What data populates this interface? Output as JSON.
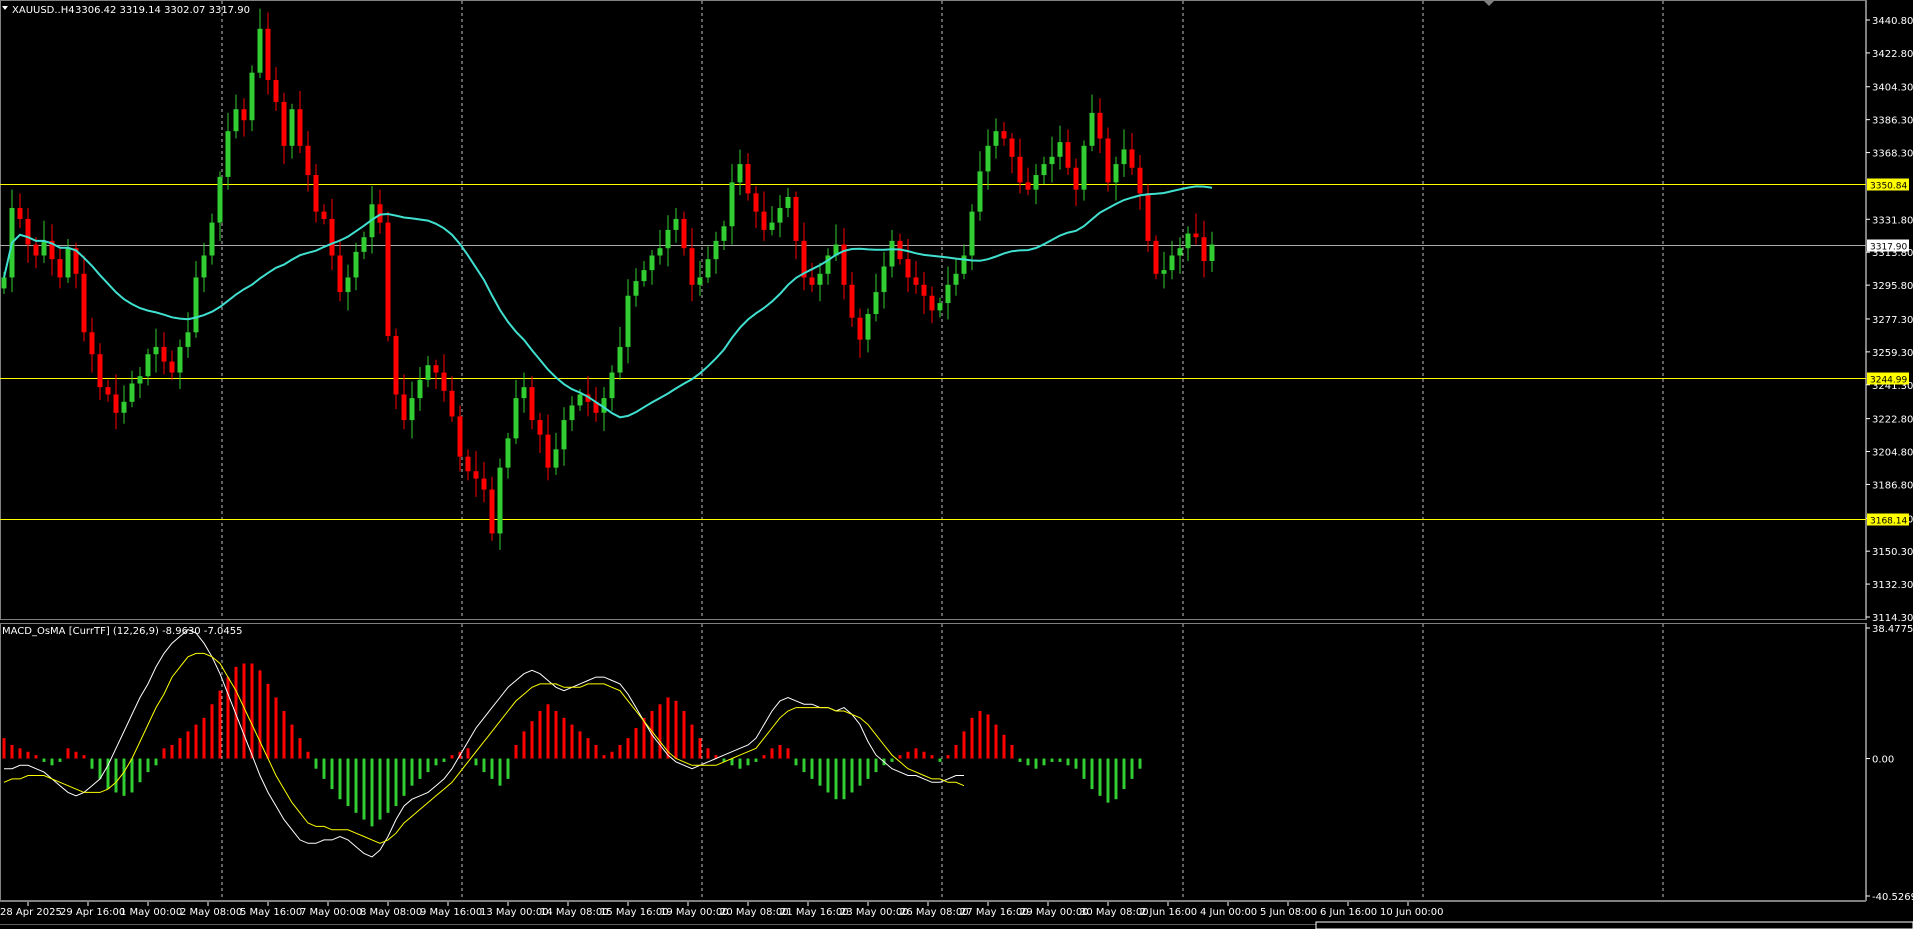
{
  "window": {
    "symbol_label": "XAUUSD..H4",
    "ohlc_readout": "3306.42 3319.14 3302.07 3317.90",
    "indicator_label": "MACD_OsMA [CurrTF] (12,26,9) -8.9630 -7.0455"
  },
  "colors": {
    "background": "#000000",
    "bull": "#32cd32",
    "bear": "#ff0000",
    "ma": "#40e0d0",
    "hline": "#ffff00",
    "grid": "#c0c0c0",
    "macd_main": "#ffffff",
    "macd_signal": "#ffff00",
    "axis_text": "#ffffff",
    "current_price_line": "#a9a9a9"
  },
  "chart_data": [
    {
      "type": "candlestick",
      "symbol": "XAUUSD..H4",
      "ylim": [
        3114.3,
        3440.8
      ],
      "y_ticks": [
        "3440.80",
        "3422.80",
        "3404.30",
        "3386.30",
        "3368.30",
        "3331.80",
        "3313.80",
        "3295.80",
        "3277.30",
        "3259.30",
        "3241.30",
        "3222.80",
        "3204.80",
        "3186.80",
        "3168.30",
        "3150.30",
        "3132.30",
        "3114.30"
      ],
      "x_ticks": [
        "28 Apr 2025",
        "29 Apr 16:00",
        "1 May 00:00",
        "2 May 08:00",
        "5 May 16:00",
        "7 May 00:00",
        "8 May 08:00",
        "9 May 16:00",
        "13 May 00:00",
        "14 May 08:00",
        "15 May 16:00",
        "19 May 00:00",
        "20 May 08:00",
        "21 May 16:00",
        "23 May 00:00",
        "26 May 08:00",
        "27 May 16:00",
        "29 May 00:00",
        "30 May 08:00",
        "2 Jun 16:00",
        "4 Jun 00:00",
        "5 Jun 08:00",
        "6 Jun 16:00",
        "10 Jun 00:00"
      ],
      "horizontal_levels": [
        {
          "label": "3350.84",
          "value": 3350.84,
          "style": "yellow"
        },
        {
          "label": "3244.99",
          "value": 3244.99,
          "style": "yellow"
        },
        {
          "label": "3168.14",
          "value": 3168.14,
          "style": "yellow"
        },
        {
          "label": "3317.90",
          "value": 3317.9,
          "style": "current"
        }
      ],
      "ma_period_note": "",
      "closes": [
        3300,
        3338,
        3332,
        3318,
        3312,
        3320,
        3310,
        3300,
        3316,
        3302,
        3270,
        3258,
        3240,
        3236,
        3226,
        3232,
        3242,
        3246,
        3258,
        3262,
        3254,
        3248,
        3262,
        3270,
        3300,
        3312,
        3330,
        3355,
        3380,
        3392,
        3386,
        3412,
        3436,
        3408,
        3396,
        3372,
        3392,
        3372,
        3356,
        3336,
        3332,
        3312,
        3292,
        3300,
        3314,
        3322,
        3340,
        3330,
        3268,
        3236,
        3222,
        3234,
        3244,
        3252,
        3248,
        3238,
        3224,
        3202,
        3194,
        3190,
        3184,
        3160,
        3196,
        3212,
        3234,
        3240,
        3222,
        3214,
        3196,
        3206,
        3222,
        3230,
        3236,
        3232,
        3226,
        3234,
        3248,
        3262,
        3290,
        3298,
        3304,
        3312,
        3316,
        3326,
        3332,
        3316,
        3296,
        3300,
        3310,
        3320,
        3328,
        3352,
        3362,
        3346,
        3336,
        3326,
        3330,
        3338,
        3344,
        3320,
        3300,
        3296,
        3302,
        3312,
        3318,
        3296,
        3278,
        3266,
        3280,
        3292,
        3306,
        3320,
        3310,
        3300,
        3296,
        3290,
        3282,
        3286,
        3296,
        3302,
        3312,
        3336,
        3358,
        3372,
        3380,
        3376,
        3366,
        3352,
        3348,
        3356,
        3362,
        3366,
        3374,
        3360,
        3348,
        3372,
        3390,
        3376,
        3352,
        3362,
        3370,
        3360,
        3346,
        3320,
        3302,
        3304,
        3312,
        3316,
        3324,
        3322,
        3309,
        3318
      ]
    },
    {
      "type": "bar",
      "name": "",
      "ylim": [
        -40.5269,
        38.4775
      ],
      "y_ticks": [
        "38.4775",
        "0.00",
        "-40.5269"
      ],
      "osma_bars": [
        6,
        4,
        3,
        2,
        1,
        -1,
        -2,
        -1,
        3,
        2,
        1,
        -3,
        -6,
        -9,
        -10,
        -11,
        -10,
        -7,
        -4,
        -2,
        3,
        4,
        6,
        8,
        10,
        12,
        16,
        20,
        24,
        27,
        28,
        28,
        26,
        22,
        18,
        14,
        10,
        6,
        2,
        -3,
        -6,
        -9,
        -12,
        -14,
        -16,
        -18,
        -20,
        -18,
        -16,
        -14,
        -11,
        -8,
        -6,
        -4,
        -2,
        -1,
        1,
        2,
        3,
        -2,
        -4,
        -6,
        -8,
        -6,
        4,
        8,
        11,
        14,
        16,
        14,
        12,
        10,
        8,
        6,
        4,
        1,
        2,
        4,
        6,
        9,
        12,
        14,
        16,
        18,
        17,
        14,
        10,
        6,
        3,
        1,
        -1,
        -2,
        -3,
        -2,
        -1,
        1,
        3,
        4,
        3,
        -2,
        -4,
        -6,
        -8,
        -10,
        -12,
        -12,
        -10,
        -8,
        -6,
        -4,
        -2,
        -1,
        1,
        2,
        3,
        2,
        1,
        -1,
        1,
        4,
        8,
        12,
        14,
        13,
        10,
        7,
        4,
        -1,
        -2,
        -3,
        -2,
        -1,
        -1,
        -2,
        -3,
        -6,
        -9,
        -11,
        -13,
        -12,
        -9,
        -6,
        -3
      ],
      "macd_main": [
        -3,
        -3,
        -2,
        -2,
        -3,
        -4,
        -6,
        -8,
        -10,
        -11,
        -10,
        -8,
        -6,
        -2,
        3,
        8,
        13,
        18,
        22,
        27,
        31,
        34,
        36,
        38,
        37,
        34,
        30,
        25,
        19,
        13,
        7,
        1,
        -5,
        -10,
        -14,
        -18,
        -21,
        -24,
        -25,
        -25,
        -24,
        -24,
        -23,
        -24,
        -26,
        -28,
        -29,
        -27,
        -23,
        -18,
        -14,
        -12,
        -11,
        -10,
        -8,
        -6,
        -3,
        1,
        5,
        9,
        12,
        15,
        18,
        21,
        23,
        25,
        26,
        25,
        23,
        21,
        20,
        21,
        22,
        23,
        24,
        24,
        23,
        22,
        19,
        15,
        11,
        7,
        4,
        1,
        -1,
        -2,
        -3,
        -2,
        -1,
        0,
        1,
        2,
        3,
        4,
        6,
        10,
        14,
        17,
        18,
        17,
        16,
        16,
        15,
        15,
        14,
        15,
        13,
        10,
        5,
        1,
        -1,
        -3,
        -4,
        -5,
        -5,
        -6,
        -7,
        -7,
        -6,
        -5,
        -5
      ],
      "macd_signal": [
        -7,
        -6,
        -6,
        -5,
        -5,
        -5,
        -6,
        -7,
        -8,
        -9,
        -10,
        -10,
        -10,
        -9,
        -7,
        -4,
        0,
        5,
        10,
        15,
        19,
        24,
        27,
        30,
        31,
        31,
        30,
        28,
        24,
        20,
        15,
        10,
        5,
        0,
        -5,
        -9,
        -13,
        -16,
        -19,
        -20,
        -20,
        -21,
        -21,
        -21,
        -22,
        -23,
        -24,
        -25,
        -24,
        -22,
        -19,
        -17,
        -15,
        -13,
        -11,
        -9,
        -7,
        -4,
        -1,
        2,
        5,
        8,
        11,
        14,
        17,
        19,
        21,
        22,
        22,
        22,
        21,
        21,
        21,
        22,
        22,
        22,
        21,
        20,
        17,
        14,
        11,
        8,
        5,
        2,
        0,
        -1,
        -2,
        -2,
        -2,
        -2,
        -1,
        0,
        1,
        2,
        3,
        6,
        9,
        12,
        14,
        15,
        15,
        15,
        15,
        15,
        14,
        14,
        13,
        12,
        10,
        7,
        4,
        1,
        -1,
        -3,
        -4,
        -5,
        -6,
        -6,
        -7,
        -7,
        -8
      ]
    }
  ]
}
